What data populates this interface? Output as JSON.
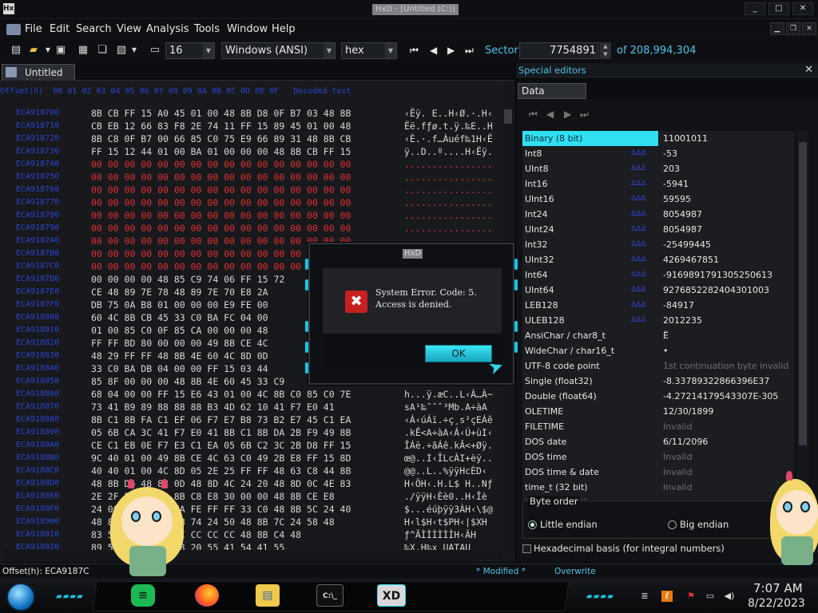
{
  "window": {
    "title": "HxD - [Untitled (C:)]",
    "app_icon": "HxD"
  },
  "menu": [
    "File",
    "Edit",
    "Search",
    "View",
    "Analysis",
    "Tools",
    "Window",
    "Help"
  ],
  "toolbar": {
    "bytes_per_row": "16",
    "charset": "Windows (ANSI)",
    "offset_base": "hex",
    "sector_label": "Sector",
    "sector_value": "7754891",
    "sector_total": "of 208,994,304"
  },
  "editor": {
    "tab_label": "Untitled (C:)",
    "header": "Offset(h)  00 01 02 03 04 05 06 07 08 09 0A 0B 0C 0D 0E 0F   Decoded text",
    "rows": [
      {
        "offset": "ECA918700",
        "bytes": "8B CB FF 15 A0 45 01 00 48 8B D8 0F B7 03 48 8B",
        "text": "‹Ëÿ. E..H‹Ø.·.H‹",
        "zero": false
      },
      {
        "offset": "ECA918710",
        "bytes": "CB EB 12 66 83 F8 2E 74 11 FF 15 89 45 01 00 48",
        "text": "Ëë.fƒø.t.ÿ.‰E..H",
        "zero": false
      },
      {
        "offset": "ECA918720",
        "bytes": "8B C8 0F B7 00 66 85 C0 75 E9 66 89 31 48 8B CB",
        "text": "‹È.·.f…Àuéf‰1H‹Ë",
        "zero": false
      },
      {
        "offset": "ECA918730",
        "bytes": "FF 15 12 44 01 00 BA 01 00 00 00 48 8B CB FF 15",
        "text": "ÿ..D..º....H‹Ëÿ.",
        "zero": false
      },
      {
        "offset": "ECA918740",
        "bytes": "00 00 00 00 00 00 00 00 00 00 00 00 00 00 00 00",
        "text": "................",
        "zero": true
      },
      {
        "offset": "ECA918750",
        "bytes": "00 00 00 00 00 00 00 00 00 00 00 00 00 00 00 00",
        "text": "................",
        "zero": true
      },
      {
        "offset": "ECA918760",
        "bytes": "00 00 00 00 00 00 00 00 00 00 00 00 00 00 00 00",
        "text": "................",
        "zero": true
      },
      {
        "offset": "ECA918770",
        "bytes": "00 00 00 00 00 00 00 00 00 00 00 00 00 00 00 00",
        "text": "................",
        "zero": true
      },
      {
        "offset": "ECA918780",
        "bytes": "00 00 00 00 00 00 00 00 00 00 00 00 00 00 00 00",
        "text": "................",
        "zero": true
      },
      {
        "offset": "ECA918790",
        "bytes": "00 00 00 00 00 00 00 00 00 00 00 00 00 00 00 00",
        "text": "................",
        "zero": true
      },
      {
        "offset": "ECA9187A0",
        "bytes": "00 00 00 00 00 00 00 00 00 00 00 00 00 00 00 00",
        "text": "................",
        "zero": true
      },
      {
        "offset": "ECA9187B0",
        "bytes": "00 00 00 00 00 00 00 00 00 00 00 00 00 00 00 00",
        "text": "................",
        "zero": true
      },
      {
        "offset": "ECA9187C0",
        "bytes": "00 00 00 00 00 00 00 00 00 00 00 00 00 00 00 00",
        "text": "................",
        "zero": true
      },
      {
        "offset": "ECA9187D0",
        "bytes": "00 00 00 00 48 85 C9 74 06 FF 15 72",
        "text": "",
        "zero": false
      },
      {
        "offset": "ECA9187E0",
        "bytes": "CE 48 89 7E 78 48 89 7E 70 E8 2A",
        "text": "",
        "zero": false
      },
      {
        "offset": "ECA9187F0",
        "bytes": "DB 75 0A B8 01 00 00 00 E9 FE 00",
        "text": "",
        "zero": false
      },
      {
        "offset": "ECA918800",
        "bytes": "60 4C 8B CB 45 33 C0 BA FC 04 00",
        "text": "",
        "zero": false
      },
      {
        "offset": "ECA918810",
        "bytes": "01 00 85 C0 0F 85 CA 00 00 00 48",
        "text": "",
        "zero": false
      },
      {
        "offset": "ECA918820",
        "bytes": "FF FF BD 80 00 00 00 49 8B CE 4C",
        "text": "",
        "zero": false
      },
      {
        "offset": "ECA918830",
        "bytes": "48 29 FF FF 48 8B 4E 60 4C 8D 0D",
        "text": "",
        "zero": false
      },
      {
        "offset": "ECA918840",
        "bytes": "33 C0 BA DB 04 00 00 FF 15 03 44",
        "text": "",
        "zero": false
      },
      {
        "offset": "ECA918850",
        "bytes": "85 8F 00 00 00 48 8B 4E 60 45 33 C9",
        "text": "",
        "zero": false
      },
      {
        "offset": "ECA918860",
        "bytes": "68 04 00 00 FF 15 E6 43 01 00 4C 8B C0 85 C0 7E",
        "text": "h...ÿ.æC..L‹À…À~",
        "zero": false
      },
      {
        "offset": "ECA918870",
        "bytes": "73 41 B9 89 88 88 88 B3 4D 62 10 41 F7 E0 41",
        "text": "sA¹‰ˆˆˆ³Mb.A÷àA",
        "zero": false
      },
      {
        "offset": "ECA918880",
        "bytes": "8B C1 8B FA C1 EF 06 F7 E7 B8 73 B2 E7 45 C1 EA",
        "text": "‹Á‹úÁï.÷ç¸s²çEÁê",
        "zero": false
      },
      {
        "offset": "ECA918890",
        "bytes": "05 6B CA 3C 41 F7 E0 41 8B C1 8B DA 2B F9 49 8B",
        "text": ".kÊ<A÷àA‹Á‹Ú+ùI‹",
        "zero": false
      },
      {
        "offset": "ECA9188A0",
        "bytes": "CE C1 EB 0E F7 E3 C1 EA 05 6B C2 3C 2B D8 FF 15",
        "text": "ÎÁë.÷ãÁê.kÂ<+Øÿ.",
        "zero": false
      },
      {
        "offset": "ECA9188B0",
        "bytes": "9C 40 01 00 49 8B CE 4C 63 C0 49 2B E8 FF 15 8D",
        "text": "œ@..I‹ÎLcÀI+èÿ..",
        "zero": false
      },
      {
        "offset": "ECA9188C0",
        "bytes": "40 40 01 00 4C 8D 05 2E 25 FF FF 48 63 C8 44 8B",
        "text": "@@..L..%ÿÿHcÈD‹",
        "zero": false
      },
      {
        "offset": "ECA9188D0",
        "bytes": "48 8B D6 48 8B 0D 48 8D 4C 24 20 48 8D 0C 4E 83",
        "text": "H‹ÖH‹.H.L$ H..Nƒ",
        "zero": false
      },
      {
        "offset": "ECA9188E0",
        "bytes": "2E 2F FF FF 48 8B C8 E8 30 00 00 48 8B CE E8",
        "text": "./ÿÿH‹Èè0..H‹Îè",
        "zero": false
      },
      {
        "offset": "ECA9188F0",
        "bytes": "24 00 00 00 E9 FA FE FF FF 33 C0 48 8B 5C 24 40",
        "text": "$...éúþÿÿ3ÀH‹\\$@",
        "zero": false
      },
      {
        "offset": "ECA918900",
        "bytes": "48 8B 6C 24 48 8B 74 24 50 48 8B 7C 24 58 48",
        "text": "H‹l$H‹t$PH‹|$XH",
        "zero": false
      },
      {
        "offset": "ECA918910",
        "bytes": "83 5E C3 CC CC CC CC CC CC 48 8B C4 48",
        "text": "ƒ^ÃÌÌÌÌÌÌH‹ÄH",
        "zero": false
      },
      {
        "offset": "ECA918920",
        "bytes": "89 58 10 48 89 78 20 55 41 54 41 55",
        "text": "‰X.H‰x UATAU",
        "zero": false
      }
    ]
  },
  "special_editors": {
    "title": "Special editors",
    "tab": "Data inspector",
    "rows": [
      {
        "label": "Binary (8 bit)",
        "btn": "",
        "value": "11001011",
        "sel": true,
        "dim": false
      },
      {
        "label": "Int8",
        "btn": "ΔΔΔ",
        "value": "-53",
        "sel": false,
        "dim": false
      },
      {
        "label": "UInt8",
        "btn": "ΔΔΔ",
        "value": "203",
        "sel": false,
        "dim": false
      },
      {
        "label": "Int16",
        "btn": "ΔΔΔ",
        "value": "-5941",
        "sel": false,
        "dim": false
      },
      {
        "label": "UInt16",
        "btn": "ΔΔΔ",
        "value": "59595",
        "sel": false,
        "dim": false
      },
      {
        "label": "Int24",
        "btn": "ΔΔΔ",
        "value": "8054987",
        "sel": false,
        "dim": false
      },
      {
        "label": "UInt24",
        "btn": "ΔΔΔ",
        "value": "8054987",
        "sel": false,
        "dim": false
      },
      {
        "label": "Int32",
        "btn": "ΔΔΔ",
        "value": "-25499445",
        "sel": false,
        "dim": false
      },
      {
        "label": "UInt32",
        "btn": "ΔΔΔ",
        "value": "4269467851",
        "sel": false,
        "dim": false
      },
      {
        "label": "Int64",
        "btn": "ΔΔΔ",
        "value": "-9169891791305250613",
        "sel": false,
        "dim": false
      },
      {
        "label": "UInt64",
        "btn": "ΔΔΔ",
        "value": "9276852282404301003",
        "sel": false,
        "dim": false
      },
      {
        "label": "LEB128",
        "btn": "ΔΔΔ",
        "value": "-84917",
        "sel": false,
        "dim": false
      },
      {
        "label": "ULEB128",
        "btn": "ΔΔΔ",
        "value": "2012235",
        "sel": false,
        "dim": false
      },
      {
        "label": "AnsiChar / char8_t",
        "btn": "",
        "value": "Ë",
        "sel": false,
        "dim": false
      },
      {
        "label": "WideChar / char16_t",
        "btn": "",
        "value": "•",
        "sel": false,
        "dim": false
      },
      {
        "label": "UTF-8 code point",
        "btn": "",
        "value": "1st continuation byte invalid",
        "sel": false,
        "dim": true
      },
      {
        "label": "Single (float32)",
        "btn": "",
        "value": "-8.33789322866396E37",
        "sel": false,
        "dim": false
      },
      {
        "label": "Double (float64)",
        "btn": "",
        "value": "-4.27214179543307E-305",
        "sel": false,
        "dim": false
      },
      {
        "label": "OLETIME",
        "btn": "",
        "value": "12/30/1899",
        "sel": false,
        "dim": false
      },
      {
        "label": "FILETIME",
        "btn": "",
        "value": "Invalid",
        "sel": false,
        "dim": true
      },
      {
        "label": "DOS date",
        "btn": "",
        "value": "6/11/2096",
        "sel": false,
        "dim": false
      },
      {
        "label": "DOS time",
        "btn": "",
        "value": "Invalid",
        "sel": false,
        "dim": true
      },
      {
        "label": "DOS time & date",
        "btn": "",
        "value": "Invalid",
        "sel": false,
        "dim": true
      },
      {
        "label": "time_t (32 bit)",
        "btn": "",
        "value": "Invalid",
        "sel": false,
        "dim": true
      },
      {
        "label": "time_t (64 bit)",
        "btn": "",
        "value": "",
        "sel": false,
        "dim": true
      }
    ],
    "byte_order_label": "Byte order",
    "little_endian": "Little endian",
    "big_endian": "Big endian",
    "hex_basis": "Hexadecimal basis (for integral numbers)"
  },
  "status": {
    "offset": "Offset(h): ECA9187C",
    "modified": "* Modified *",
    "mode": "Overwrite"
  },
  "dialog": {
    "title": "HxD",
    "message_line1": "System Error.  Code: 5.",
    "message_line2": "Access is denied.",
    "ok_label": "OK"
  },
  "taskbar": {
    "time": "7:07 AM",
    "date": "8/22/2023",
    "apps": [
      "spotify-icon",
      "firefox-icon",
      "file-explorer-icon",
      "command-prompt-icon",
      "hxd-icon"
    ]
  },
  "colors": {
    "accent": "#2fe0f2",
    "offset_blue": "#2b44d0",
    "zero_red": "#e03030",
    "error_red": "#c8201e"
  }
}
